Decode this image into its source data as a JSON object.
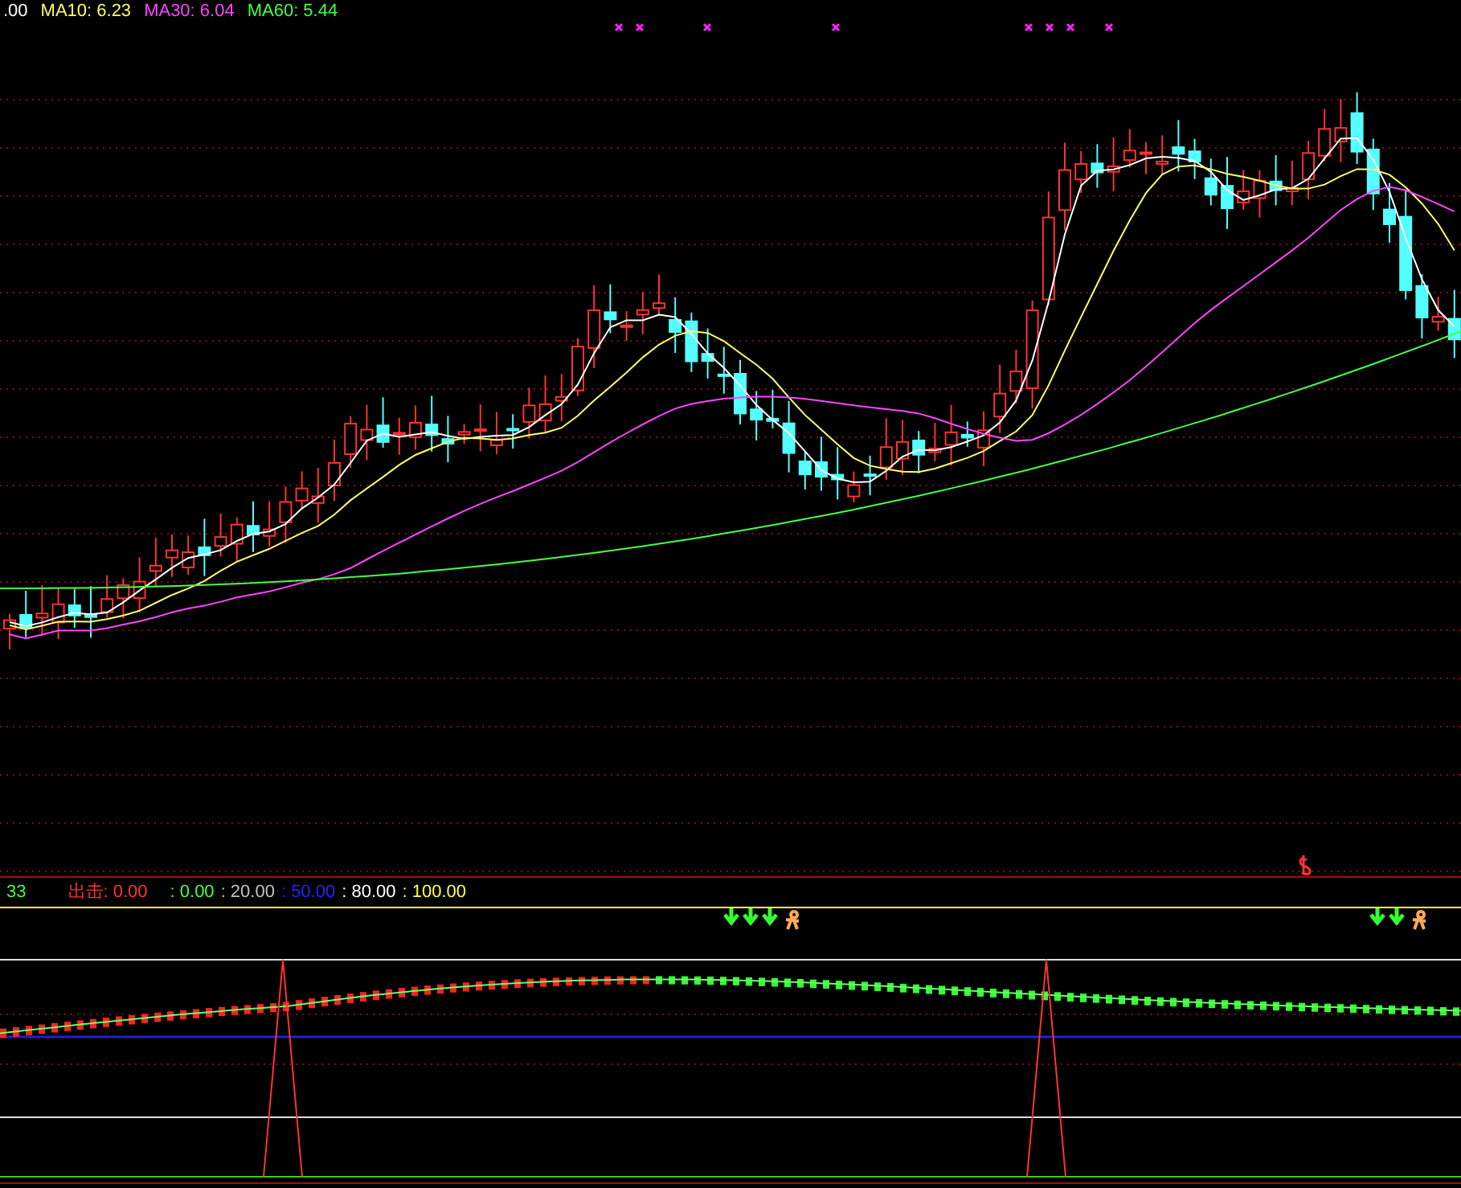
{
  "chart_header": [
    {
      "text": ".00",
      "color": "#ffffff"
    },
    {
      "text": "MA10: 6.23",
      "color": "#ffff66"
    },
    {
      "text": "MA30: 6.04",
      "color": "#ff44ff"
    },
    {
      "text": "MA60: 5.44",
      "color": "#44ff44"
    }
  ],
  "indicator_header": [
    {
      "text": "33",
      "color": "#44ff44"
    },
    {
      "text": "出击: 0.00",
      "color": "#ff3333"
    },
    {
      "text": ": 0.00",
      "color": "#44ff44"
    },
    {
      "text": ": 20.00",
      "color": "#c0c0c0"
    },
    {
      "text": ": 50.00",
      "color": "#2222ff"
    },
    {
      "text": ": 80.00",
      "color": "#ffffff"
    },
    {
      "text": ": 100.00",
      "color": "#ffff44"
    }
  ]
}
